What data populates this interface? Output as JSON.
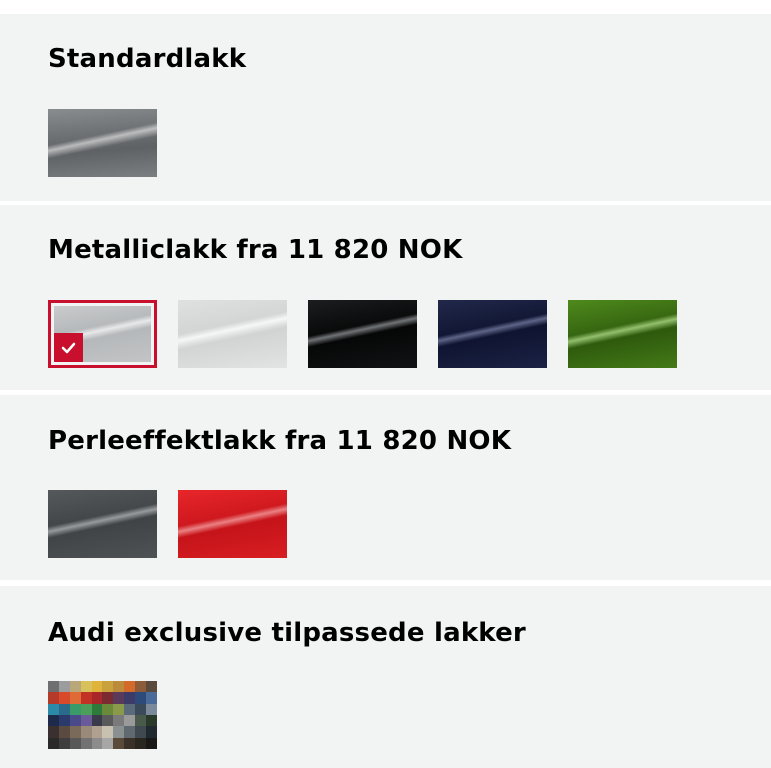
{
  "sections": [
    {
      "title": "Standardlakk",
      "swatches": [
        {
          "color_name": "standard-grey",
          "base_color": "#6f7275"
        }
      ]
    },
    {
      "title": "Metalliclakk fra 11 820 NOK",
      "swatches": [
        {
          "color_name": "silver",
          "base_color": "#b3b6b8",
          "selected": true
        },
        {
          "color_name": "glacier-white",
          "base_color": "#d6d8d7"
        },
        {
          "color_name": "black",
          "base_color": "#0a0b0c"
        },
        {
          "color_name": "navy-blue",
          "base_color": "#141a3a"
        },
        {
          "color_name": "green",
          "base_color": "#3a6b12"
        }
      ]
    },
    {
      "title": "Perleeffektlakk fra 11 820 NOK",
      "swatches": [
        {
          "color_name": "dark-grey-pearl",
          "base_color": "#45494b"
        },
        {
          "color_name": "red-pearl",
          "base_color": "#d01a1e"
        }
      ]
    },
    {
      "title": "Audi exclusive tilpassede lakker",
      "swatches": [
        {
          "color_name": "exclusive-palette",
          "base_color": "multicolor"
        }
      ]
    }
  ],
  "accent_color": "#c8102e",
  "section_background": "#f2f3f3",
  "icons": {
    "selected_badge": "checkmark-icon"
  }
}
